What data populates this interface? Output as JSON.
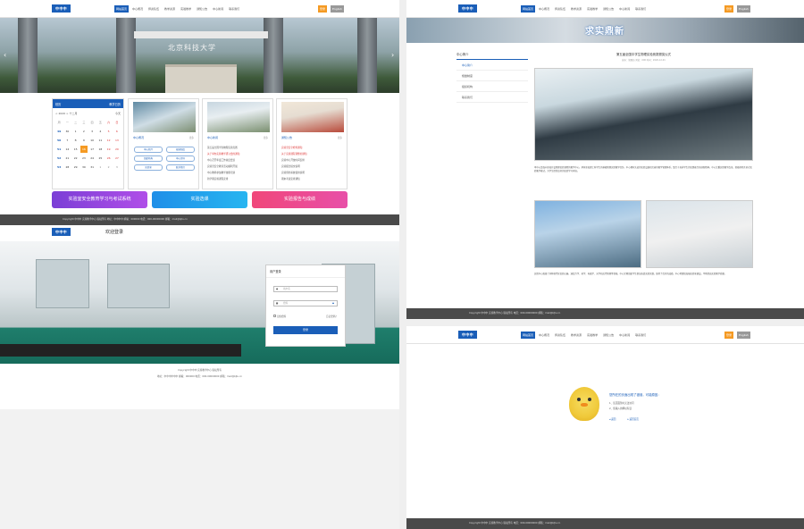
{
  "brand": {
    "logo": "中中中",
    "primary": "#1a5eb8",
    "accent": "#f59a23"
  },
  "nav": [
    "网站首页",
    "中心概况",
    "师资队伍",
    "教学资源",
    "实验教学",
    "通知公告",
    "中心新闻",
    "联系我们"
  ],
  "topbar_buttons": {
    "login": "登录",
    "lang": "English"
  },
  "home": {
    "hero_title": "北京科技大学",
    "calendar": {
      "title": "校历",
      "link": "教学日历",
      "selector": "< 2020 > 十二月",
      "today_btn": "今天",
      "weekdays": [
        "周",
        "一",
        "二",
        "三",
        "四",
        "五",
        "六",
        "日"
      ],
      "rows": [
        [
          "49",
          "30",
          "1",
          "2",
          "3",
          "4",
          "5",
          "6"
        ],
        [
          "50",
          "7",
          "8",
          "9",
          "10",
          "11",
          "12",
          "13"
        ],
        [
          "51",
          "14",
          "15",
          "16",
          "17",
          "18",
          "19",
          "20"
        ],
        [
          "52",
          "21",
          "22",
          "23",
          "24",
          "25",
          "26",
          "27"
        ],
        [
          "53",
          "28",
          "29",
          "30",
          "31",
          "1",
          "2",
          "3"
        ]
      ]
    },
    "cards": [
      {
        "category": "中心概况",
        "more": "更多",
        "pills": [
          "中心简介",
          "规章制度",
          "组织机构",
          "中心领导",
          "实验室",
          "联系我们"
        ]
      },
      {
        "category": "中心新闻",
        "more": "更多",
        "items": [
          "第五届全国学生物理实验竞赛",
          "关于举办实验教学研讨会的通知",
          "中心召开年度工作总结会议",
          "实验室安全教育活动顺利开展",
          "中心教师参加教学技能培训",
          "新学期实验课程安排"
        ]
      },
      {
        "category": "通知公告",
        "more": "更多",
        "items": [
          "实验室安全检查通知",
          "关于实验课程调整的通知",
          "实验中心开放时间安排",
          "实验报告提交说明",
          "实验预约系统使用说明",
          "期末考试安排通知"
        ]
      }
    ],
    "banners": [
      "实验室安全教育学习与考试系统",
      "实验选课",
      "实验报告与成绩"
    ],
    "footer": "Copyright 中中中 实验教学中心 版权所有    地址：中中中中 邮编：000000    电话：000-00000000    邮箱：mail@bjtu.cn"
  },
  "login": {
    "welcome": "欢迎登录",
    "box_title": "用户登录",
    "username_placeholder": "用户名",
    "password_placeholder": "密码",
    "remember": "记住密码",
    "forgot": "忘记密码？",
    "submit": "登录",
    "copyright": "Copyright 中中中 实验教学中心 版权所有",
    "address": "地址：中中中中中中 邮编：000000  电话：000-00000000  邮箱：mail@bjtu.cn"
  },
  "article": {
    "banner": "求实鼎新",
    "sidebar_title": "中心简介",
    "sidebar_items": [
      "中心简介",
      "规章制度",
      "组织机构",
      "联系我们"
    ],
    "title": "第五届全国中学生物理实验竞赛颁奖仪式",
    "meta": "发布：管理员  浏览：000  时间：2020-12-01",
    "para1": "本中心是面向全校开设物理实验课程的教学中心，承担全校理工科学生的基础物理实验教学任务。中心拥有先进的实验设备和完善的教学管理体系，致力于培养学生的实践能力和创新精神。中心注重实验教学改革，积极探索开放式实验教学模式，为学生提供良好的实验学习环境。",
    "para2": "实验中心配备了多种现代化实验仪器，涵盖力学、热学、电磁学、光学和近代物理等领域。中心定期组织学生参加各类实验竞赛，取得了优异的成绩。中心将继续加强实验室建设，不断提高实验教学质量。",
    "footer": "Copyright 中中中 实验教学中心 版权所有    电话：000-00000000    邮箱：mail@bjtu.cn"
  },
  "e404": {
    "title": "您所在的页面出现了错误，可能原因：",
    "reasons": [
      "1、该页面暂时无法访问",
      "2、您输入的网址有误"
    ],
    "back": "返回",
    "home": "返回首页",
    "footer": "Copyright 中中中 实验教学中心 版权所有    电话：000-00000000    邮箱：mail@bjtu.cn"
  }
}
